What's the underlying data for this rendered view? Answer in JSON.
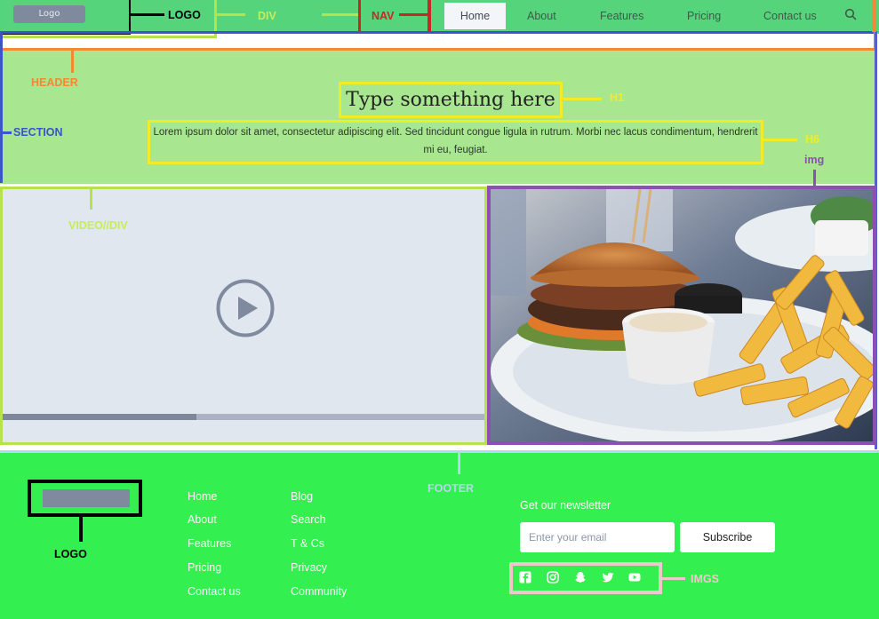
{
  "header": {
    "logo_text": "Logo",
    "nav": [
      "Home",
      "About",
      "Features",
      "Pricing",
      "Contact us"
    ]
  },
  "section": {
    "h1": "Type something here",
    "h6": "Lorem ipsum dolor sit amet, consectetur adipiscing elit. Sed tincidunt congue ligula in rutrum. Morbi nec lacus condimentum, hendrerit mi eu, feugiat."
  },
  "footer": {
    "col1": [
      "Home",
      "About",
      "Features",
      "Pricing",
      "Contact us"
    ],
    "col2": [
      "Blog",
      "Search",
      "T & Cs",
      "Privacy",
      "Community"
    ],
    "newsletter_label": "Get our newsletter",
    "email_placeholder": "Enter your email",
    "subscribe_label": "Subscribe"
  },
  "annotations": {
    "logo": "LOGO",
    "div": "DIV",
    "nav": "NAV",
    "header": "HEADER",
    "section": "SECTION",
    "h1": "H1",
    "h6": "H6",
    "img": "img",
    "video": "VIDEO//DIV",
    "footer": "FOOTER",
    "footer_logo": "LOGO",
    "imgs": "IMGS"
  },
  "colors": {
    "header_bg": "#56d47b",
    "section_bg": "#a8e68f",
    "footer_bg": "#33ef4f",
    "video_bg": "#e1e7ef"
  }
}
